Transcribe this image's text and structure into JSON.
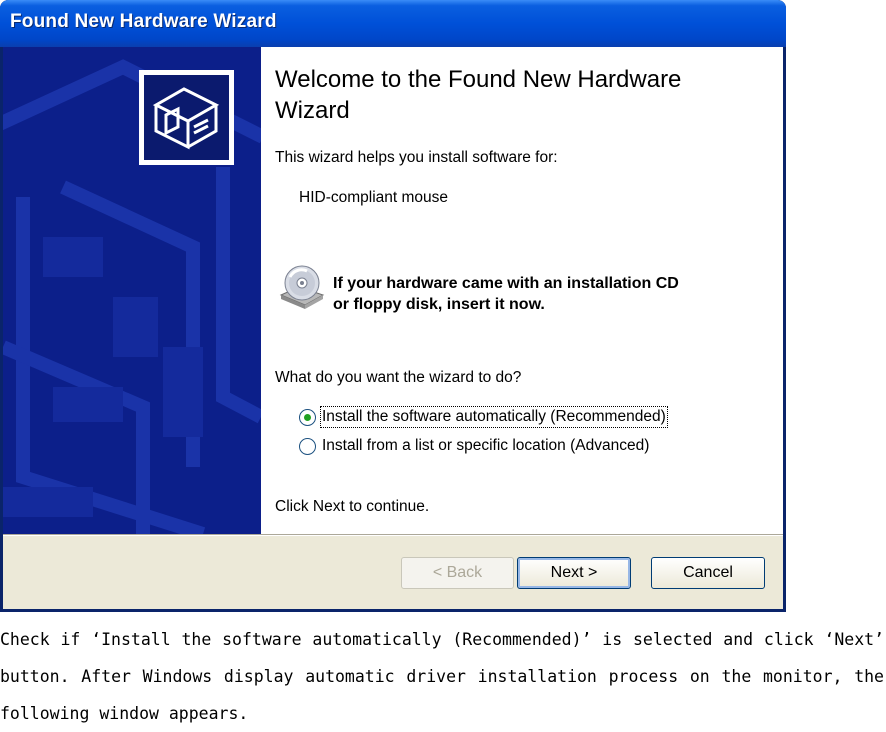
{
  "window": {
    "title": "Found New Hardware Wizard"
  },
  "content": {
    "heading": "Welcome to the Found New Hardware Wizard",
    "intro": "This wizard helps you install software for:",
    "device_name": "HID-compliant mouse",
    "cd_prompt_line1": "If your hardware came with an installation CD",
    "cd_prompt_line2": "or floppy disk, insert it now.",
    "question": "What do you want the wizard to do?",
    "options": [
      {
        "label": "Install the software automatically (Recommended)",
        "checked": true
      },
      {
        "label": "Install from a list or specific location (Advanced)",
        "checked": false
      }
    ],
    "continue_text": "Click Next to continue."
  },
  "buttons": {
    "back": "< Back",
    "next": "Next >",
    "cancel": "Cancel"
  },
  "caption": "Check if ‘Install the software automatically (Recommended)’ is selected and click ‘Next’ button. After Windows display automatic driver installation process on the monitor, the following window appears.",
  "colors": {
    "titlebar": "#0050d8",
    "banner": "#0c1f8a",
    "dialog_face": "#ece9d8",
    "radio_selected": "#21a121"
  },
  "icons": [
    "hardware-icon",
    "cd-icon",
    "radio-selected-icon",
    "radio-unselected-icon"
  ]
}
